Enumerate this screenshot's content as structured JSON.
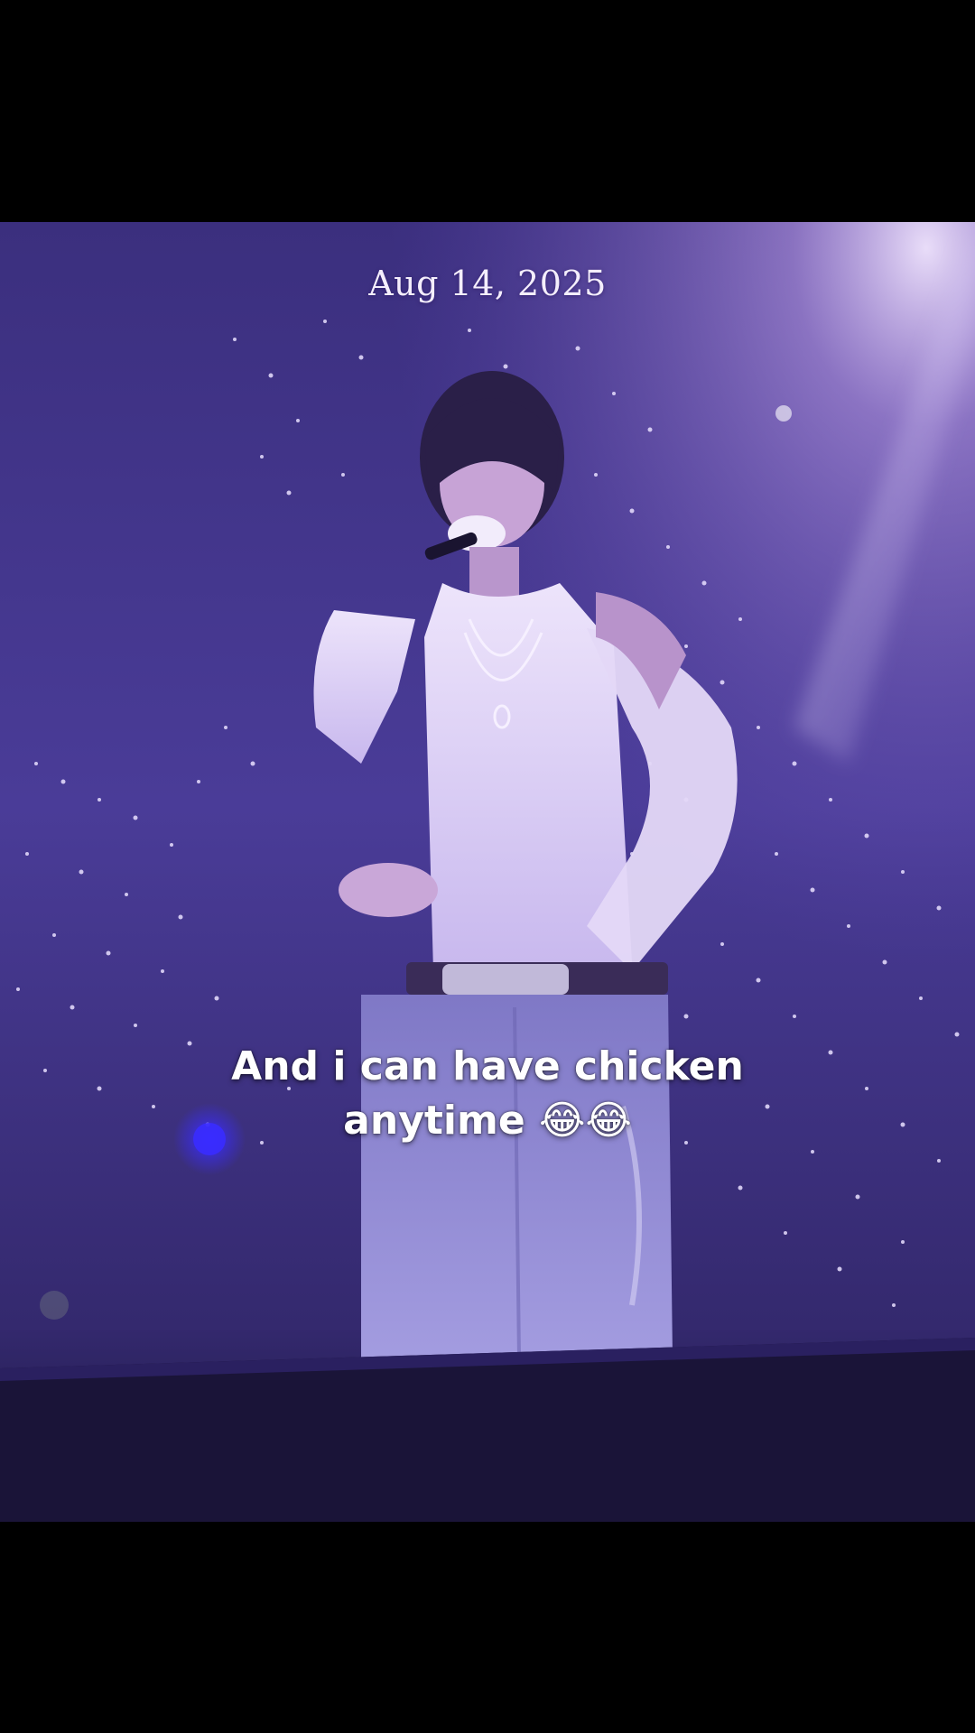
{
  "overlay": {
    "date_stamp": "Aug 14, 2025",
    "caption_line1": "And i can have chicken",
    "caption_line2": "anytime 😂😂"
  },
  "colors": {
    "letterbox": "#000000",
    "stage_purple": "#4a3a94",
    "spotlight": "#e8d8ff",
    "caption_text": "#ffffff"
  }
}
